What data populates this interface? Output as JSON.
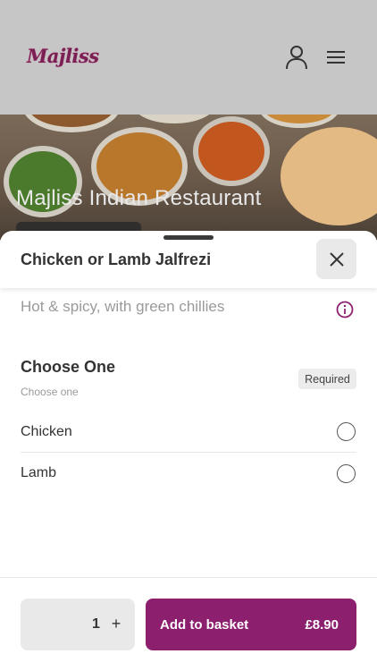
{
  "header": {
    "logo_text": "Majliss",
    "user_icon": "user-icon",
    "menu_icon": "hamburger-menu-icon"
  },
  "hero": {
    "restaurant_name": "Majliss Indian Restaurant"
  },
  "item": {
    "title": "Chicken or Lamb Jalfrezi",
    "description": "Hot & spicy, with green chillies",
    "close_icon": "close-icon",
    "info_icon": "info-icon"
  },
  "options_group": {
    "title": "Choose One",
    "subtitle": "Choose one",
    "badge": "Required",
    "options": [
      {
        "label": "Chicken",
        "selected": false
      },
      {
        "label": "Lamb",
        "selected": false
      }
    ]
  },
  "footer": {
    "quantity": "1",
    "plus_label": "+",
    "add_label": "Add to basket",
    "price": "£8.90"
  },
  "colors": {
    "brand": "#8d1f6f",
    "overlay": "#c6c6c6",
    "muted_text": "#9a9a9a"
  }
}
